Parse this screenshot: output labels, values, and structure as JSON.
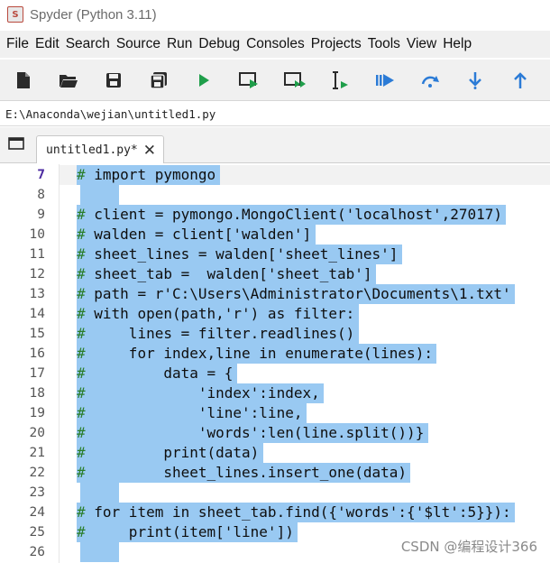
{
  "window": {
    "title": "Spyder (Python 3.11)",
    "logo_icon": "spyder-logo"
  },
  "menu": [
    "File",
    "Edit",
    "Search",
    "Source",
    "Run",
    "Debug",
    "Consoles",
    "Projects",
    "Tools",
    "View",
    "Help"
  ],
  "toolbar": [
    {
      "name": "new-file",
      "icon": "file-icon"
    },
    {
      "name": "open-file",
      "icon": "folder-icon"
    },
    {
      "name": "save-file",
      "icon": "save-icon"
    },
    {
      "name": "save-all",
      "icon": "save-all-icon"
    },
    {
      "name": "run-file",
      "icon": "play-icon"
    },
    {
      "name": "run-cell",
      "icon": "run-cell-icon"
    },
    {
      "name": "run-cell-advance",
      "icon": "run-cell-advance-icon"
    },
    {
      "name": "run-selection",
      "icon": "run-selection-icon"
    },
    {
      "name": "debug-file",
      "icon": "debug-icon"
    },
    {
      "name": "step-over",
      "icon": "step-over-icon"
    },
    {
      "name": "step-into",
      "icon": "step-into-icon"
    },
    {
      "name": "step-return",
      "icon": "step-return-icon"
    }
  ],
  "path": "E:\\Anaconda\\wejian\\untitled1.py",
  "tab": {
    "label": "untitled1.py*",
    "close": "✕"
  },
  "editor": {
    "current_line": 7,
    "lines": [
      {
        "num": "7",
        "hash": "#",
        "rest": " import pymongo"
      },
      {
        "num": "8",
        "hash": "",
        "rest": ""
      },
      {
        "num": "9",
        "hash": "#",
        "rest": " client = pymongo.MongoClient('localhost',27017)"
      },
      {
        "num": "10",
        "hash": "#",
        "rest": " walden = client['walden']"
      },
      {
        "num": "11",
        "hash": "#",
        "rest": " sheet_lines = walden['sheet_lines']"
      },
      {
        "num": "12",
        "hash": "#",
        "rest": " sheet_tab =  walden['sheet_tab']"
      },
      {
        "num": "13",
        "hash": "#",
        "rest": " path = r'C:\\Users\\Administrator\\Documents\\1.txt'"
      },
      {
        "num": "14",
        "hash": "#",
        "rest": " with open(path,'r') as filter:"
      },
      {
        "num": "15",
        "hash": "#",
        "rest": "     lines = filter.readlines()"
      },
      {
        "num": "16",
        "hash": "#",
        "rest": "     for index,line in enumerate(lines):"
      },
      {
        "num": "17",
        "hash": "#",
        "rest": "         data = {"
      },
      {
        "num": "18",
        "hash": "#",
        "rest": "             'index':index,"
      },
      {
        "num": "19",
        "hash": "#",
        "rest": "             'line':line,"
      },
      {
        "num": "20",
        "hash": "#",
        "rest": "             'words':len(line.split())}"
      },
      {
        "num": "21",
        "hash": "#",
        "rest": "         print(data)"
      },
      {
        "num": "22",
        "hash": "#",
        "rest": "         sheet_lines.insert_one(data)"
      },
      {
        "num": "23",
        "hash": "",
        "rest": ""
      },
      {
        "num": "24",
        "hash": "#",
        "rest": " for item in sheet_tab.find({'words':{'$lt':5}}):"
      },
      {
        "num": "25",
        "hash": "#",
        "rest": "     print(item['line'])"
      },
      {
        "num": "26",
        "hash": "",
        "rest": ""
      }
    ]
  },
  "watermark": "CSDN @编程设计366",
  "colors": {
    "selection": "#99c9f2",
    "comment_hash": "#2a7d2a",
    "current_line_number": "#4b2aa0",
    "toolbar_icon_green": "#1f9e4a",
    "toolbar_icon_blue": "#2b7bd6",
    "toolbar_icon_dark": "#2b2b2b"
  }
}
